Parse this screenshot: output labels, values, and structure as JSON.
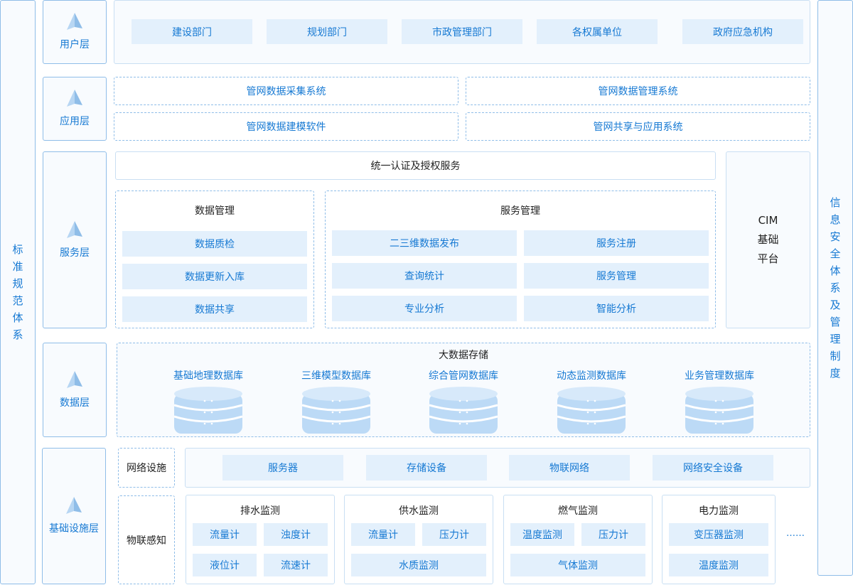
{
  "sides": {
    "left": [
      "标",
      "准",
      "规",
      "范",
      "体",
      "系"
    ],
    "right": [
      "信",
      "息",
      "安",
      "全",
      "体",
      "系",
      "及",
      "管",
      "理",
      "制",
      "度"
    ]
  },
  "layers": {
    "user": "用户层",
    "app": "应用层",
    "service": "服务层",
    "data": "数据层",
    "infra": "基础设施层"
  },
  "user_layer": {
    "units": [
      "建设部门",
      "规划部门",
      "市政管理部门",
      "各权属单位",
      "政府应急机构"
    ]
  },
  "app_layer": {
    "systems": [
      "管网数据采集系统",
      "管网数据管理系统",
      "管网数据建模软件",
      "管网共享与应用系统"
    ]
  },
  "service_layer": {
    "auth": "统一认证及授权服务",
    "data_mgmt": {
      "title": "数据管理",
      "items": [
        "数据质检",
        "数据更新入库",
        "数据共享"
      ]
    },
    "service_mgmt": {
      "title": "服务管理",
      "items": [
        "二三维数据发布",
        "服务注册",
        "查询统计",
        "服务管理",
        "专业分析",
        "智能分析"
      ]
    },
    "cim": [
      "CIM",
      "基础",
      "平台"
    ]
  },
  "data_layer": {
    "title": "大数据存储",
    "databases": [
      "基础地理数据库",
      "三维模型数据库",
      "综合管网数据库",
      "动态监测数据库",
      "业务管理数据库"
    ]
  },
  "infra_layer": {
    "network_label": "网络设施",
    "network_items": [
      "服务器",
      "存储设备",
      "物联网络",
      "网络安全设备"
    ],
    "iot_label": "物联感知",
    "groups": [
      {
        "title": "排水监测",
        "items": [
          "流量计",
          "浊度计",
          "液位计",
          "流速计"
        ]
      },
      {
        "title": "供水监测",
        "items": [
          "流量计",
          "压力计",
          "水质监测"
        ]
      },
      {
        "title": "燃气监测",
        "items": [
          "温度监测",
          "压力计",
          "气体监测"
        ]
      },
      {
        "title": "电力监测",
        "items": [
          "变压器监测",
          "温度监测"
        ]
      }
    ],
    "ellipsis": "……"
  },
  "colors": {
    "accent": "#1679d3",
    "chip_bg": "#e3f0fc",
    "border": "#8fbde8"
  }
}
